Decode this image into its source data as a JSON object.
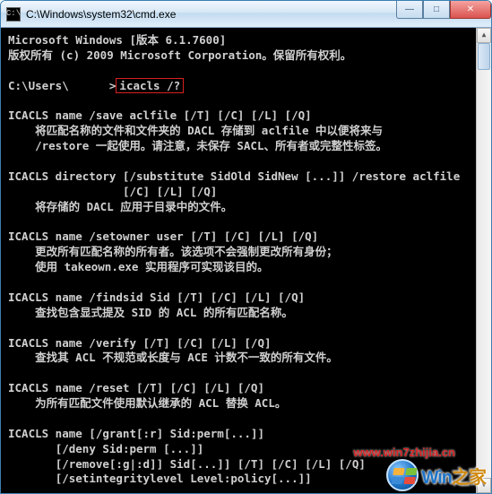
{
  "window": {
    "title": "C:\\Windows\\system32\\cmd.exe",
    "icon_label": "C:\\"
  },
  "controls": {
    "minimize": "—",
    "maximize": "□",
    "close": "✕",
    "scroll_up": "▲",
    "scroll_down": "▼"
  },
  "prompt": {
    "path_prefix": "C:\\Users\\",
    "path_suffix": ">",
    "command": "icacls /?"
  },
  "lines": {
    "l01": "Microsoft Windows [版本 6.1.7600]",
    "l02": "版权所有 (c) 2009 Microsoft Corporation。保留所有权利。",
    "l03": "ICACLS name /save aclfile [/T] [/C] [/L] [/Q]",
    "l04": "    将匹配名称的文件和文件夹的 DACL 存储到 aclfile 中以便将来与",
    "l05": "    /restore 一起使用。请注意，未保存 SACL、所有者或完整性标签。",
    "l06": "ICACLS directory [/substitute SidOld SidNew [...]] /restore aclfile",
    "l07": "                 [/C] [/L] [/Q]",
    "l08": "    将存储的 DACL 应用于目录中的文件。",
    "l09": "ICACLS name /setowner user [/T] [/C] [/L] [/Q]",
    "l10": "    更改所有匹配名称的所有者。该选项不会强制更改所有身份；",
    "l11": "    使用 takeown.exe 实用程序可实现该目的。",
    "l12": "ICACLS name /findsid Sid [/T] [/C] [/L] [/Q]",
    "l13": "    查找包含显式提及 SID 的 ACL 的所有匹配名称。",
    "l14": "ICACLS name /verify [/T] [/C] [/L] [/Q]",
    "l15": "    查找其 ACL 不规范或长度与 ACE 计数不一致的所有文件。",
    "l16": "ICACLS name /reset [/T] [/C] [/L] [/Q]",
    "l17": "    为所有匹配文件使用默认继承的 ACL 替换 ACL。",
    "l18": "ICACLS name [/grant[:r] Sid:perm[...]]",
    "l19": "       [/deny Sid:perm [...]]",
    "l20": "       [/remove[:g|:d]] Sid[...]] [/T] [/C] [/L] [/Q]",
    "l21": "       [/setintegritylevel Level:policy[...]]"
  },
  "watermark": {
    "url": "www.win7zhijia.cn",
    "brand_left": "Win",
    "brand_right": "之家"
  }
}
